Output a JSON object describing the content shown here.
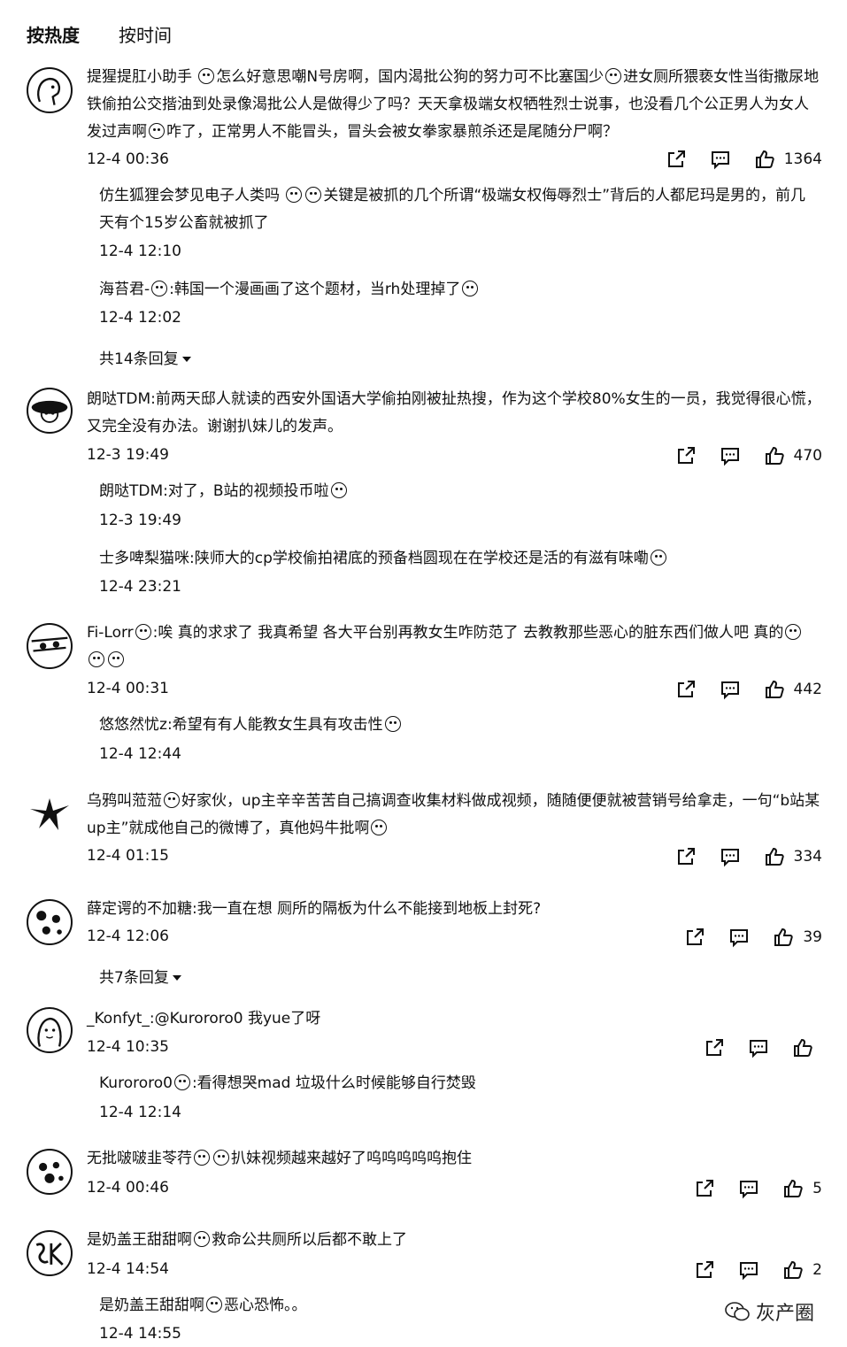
{
  "tabs": [
    {
      "label": "按热度",
      "active": true
    },
    {
      "label": "按时间",
      "active": false
    }
  ],
  "comments": [
    {
      "user": "提猩提肛小助手",
      "text_a": "怎么好意思嘲N号房啊，国内渴批公狗的努力可不比塞国少",
      "text_b": "进女厕所猥亵女性当街撒尿地铁偷拍公交揩油到处录像渴批公人是做得少了吗？天天拿极端女权牺牲烈士说事，也没看几个公正男人为女人发过声啊",
      "text_c": "咋了，正常男人不能冒头，冒头会被女拳家暴煎杀还是尾随分尸啊？",
      "time": "12-4 00:36",
      "likes": "1364",
      "replies": [
        {
          "user": "仿生狐狸会梦见电子人类吗",
          "text": "关键是被抓的几个所谓“极端女权侮辱烈士”背后的人都尼玛是男的，前几天有个15岁公畜就被抓了",
          "time": "12-4 12:10"
        },
        {
          "user": "海苔君-",
          "text": ":韩国一个漫画画了这个题材，当rh处理掉了",
          "time": "12-4 12:02"
        }
      ],
      "more": "共14条回复"
    },
    {
      "user": "朗哒TDM",
      "text": ":前两天邸人就读的西安外国语大学偷拍刚被扯热搜，作为这个学校80%女生的一员，我觉得很心慌，又完全没有办法。谢谢扒妹儿的发声。",
      "time": "12-3 19:49",
      "likes": "470",
      "replies": [
        {
          "user": "朗哒TDM",
          "text": ":对了，B站的视频投币啦",
          "time": "12-3 19:49"
        },
        {
          "user": "士多啤梨猫咪",
          "text": ":陕师大的cp学校偷拍裙底的预备档圆现在在学校还是活的有滋有味嘞",
          "time": "12-4 23:21"
        }
      ]
    },
    {
      "user": "Fi-Lorr",
      "text": ":唉 真的求求了 我真希望 各大平台别再教女生咋防范了 去教教那些恶心的脏东西们做人吧 真的",
      "time": "12-4 00:31",
      "likes": "442",
      "replies": [
        {
          "user": "悠悠然忧z",
          "text": ":希望有有人能教女生具有攻击性",
          "time": "12-4 12:44"
        }
      ]
    },
    {
      "user": "乌鸦叫蒞蒞",
      "text": "好家伙，up主辛辛苦苦自己搞调查收集材料做成视频，随随便便就被营销号给拿走，一句“b站某up主”就成他自己的微博了，真他妈牛批啊",
      "time": "12-4 01:15",
      "likes": "334",
      "replies": []
    },
    {
      "user": "薛定谔的不加糖",
      "text": ":我一直在想 厕所的隔板为什么不能接到地板上封死?",
      "time": "12-4 12:06",
      "likes": "39",
      "replies": [],
      "more": "共7条回复"
    },
    {
      "user": "_Konfyt_",
      "text": ":@Kurororo0 我yue了呀",
      "time": "12-4 10:35",
      "likes": "",
      "replies": [
        {
          "user": "Kurororo0",
          "text": ":看得想哭mad 垃圾什么时候能够自行焚毁",
          "time": "12-4 12:14"
        }
      ]
    },
    {
      "user": "无批啵啵韭苓荇",
      "text": "扒妹视频越来越好了呜呜呜呜呜抱住",
      "time": "12-4 00:46",
      "likes": "5",
      "replies": []
    },
    {
      "user": "是奶盖王甜甜啊",
      "text": "救命公共厕所以后都不敢上了",
      "time": "12-4 14:54",
      "likes": "2",
      "replies": [
        {
          "user": "是奶盖王甜甜啊",
          "text": "恶心恐怖。。",
          "time": "12-4 14:55"
        }
      ]
    }
  ],
  "watermark": "灰产圈",
  "icons": [
    "share-icon",
    "reply-icon",
    "like-icon",
    "caret-down-icon",
    "wechat-icon"
  ]
}
